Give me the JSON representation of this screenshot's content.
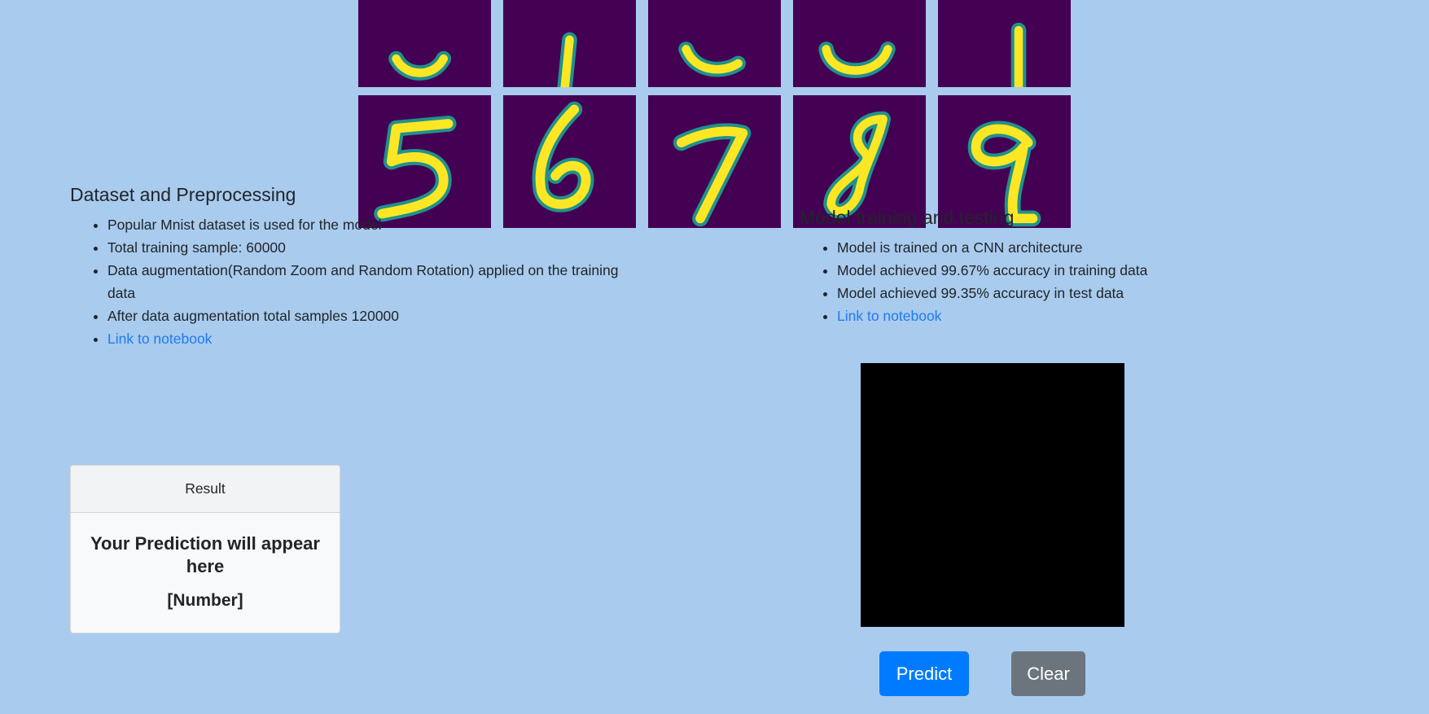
{
  "dataset": {
    "title": "Dataset and Preprocessing",
    "items": [
      "Popular Mnist dataset is used for the model",
      "Total training sample: 60000",
      "Data augmentation(Random Zoom and Random Rotation) applied on the training data",
      "After data augmentation total samples 120000"
    ],
    "link_label": "Link to notebook"
  },
  "training": {
    "title": "Model training and testing",
    "items": [
      "Model is trained on a CNN architecture",
      "Model achieved 99.67% accuracy in training data",
      "Model achieved 99.35% accuracy in test data"
    ],
    "link_label": "Link to notebook"
  },
  "result": {
    "header": "Result",
    "message": "Your Prediction will appear here",
    "number": "[Number]"
  },
  "buttons": {
    "predict_label": "Predict",
    "clear_label": "Clear"
  },
  "colors": {
    "background": "#a9cbee",
    "tile_background": "#440154",
    "stroke_outer": "#21918c",
    "stroke_inner": "#fde725",
    "predict": "#007bff",
    "clear": "#6c757d"
  }
}
